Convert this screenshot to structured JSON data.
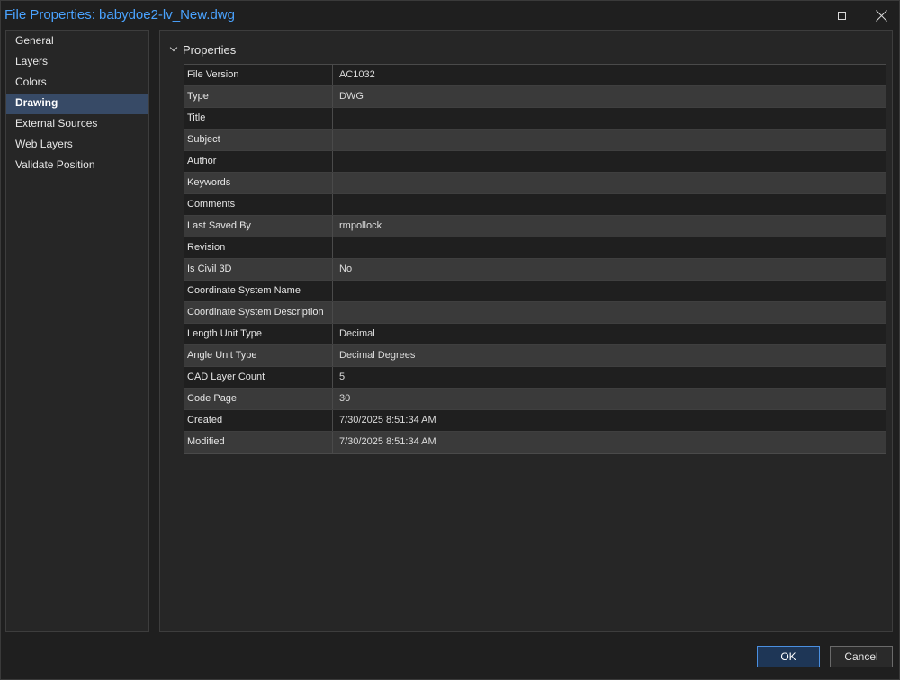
{
  "window": {
    "title": "File Properties: babydoe2-lv_New.dwg",
    "maximize_icon": "maximize-icon",
    "close_icon": "close-icon"
  },
  "sidebar": {
    "items": [
      {
        "label": "General",
        "active": false
      },
      {
        "label": "Layers",
        "active": false
      },
      {
        "label": "Colors",
        "active": false
      },
      {
        "label": "Drawing",
        "active": true
      },
      {
        "label": "External Sources",
        "active": false
      },
      {
        "label": "Web Layers",
        "active": false
      },
      {
        "label": "Validate Position",
        "active": false
      }
    ]
  },
  "properties": {
    "section_title": "Properties",
    "rows": [
      {
        "name": "File Version",
        "value": "AC1032"
      },
      {
        "name": "Type",
        "value": "DWG"
      },
      {
        "name": "Title",
        "value": ""
      },
      {
        "name": "Subject",
        "value": ""
      },
      {
        "name": "Author",
        "value": ""
      },
      {
        "name": "Keywords",
        "value": ""
      },
      {
        "name": "Comments",
        "value": ""
      },
      {
        "name": "Last Saved By",
        "value": "rmpollock"
      },
      {
        "name": "Revision",
        "value": ""
      },
      {
        "name": "Is Civil 3D",
        "value": "No"
      },
      {
        "name": "Coordinate System Name",
        "value": ""
      },
      {
        "name": "Coordinate System Description",
        "value": ""
      },
      {
        "name": "Length Unit Type",
        "value": "Decimal"
      },
      {
        "name": "Angle Unit Type",
        "value": "Decimal Degrees"
      },
      {
        "name": "CAD Layer Count",
        "value": "5"
      },
      {
        "name": "Code Page",
        "value": "30"
      },
      {
        "name": "Created",
        "value": "7/30/2025 8:51:34 AM"
      },
      {
        "name": "Modified",
        "value": "7/30/2025 8:51:34 AM"
      }
    ]
  },
  "footer": {
    "ok_label": "OK",
    "cancel_label": "Cancel"
  },
  "colors": {
    "accent": "#4aa3ff",
    "selected_nav": "#374a66",
    "ok_border": "#4a8fe0"
  }
}
